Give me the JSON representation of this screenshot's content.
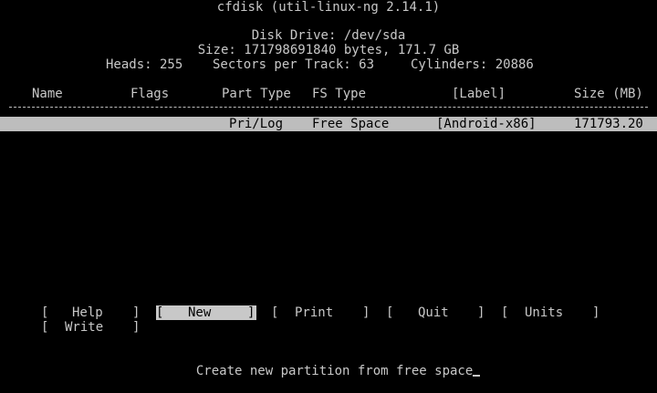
{
  "header": {
    "app_title": "cfdisk (util-linux-ng 2.14.1)",
    "disk_drive": "Disk Drive: /dev/sda",
    "size_line": "Size: 171798691840 bytes, 171.7 GB",
    "heads": "Heads: 255",
    "sectors": "Sectors per Track: 63",
    "cylinders": "Cylinders: 20886"
  },
  "table": {
    "columns": [
      "Name",
      "Flags",
      "Part Type",
      "FS Type",
      "[Label]",
      "Size (MB)"
    ],
    "rows": [
      {
        "name": "",
        "flags": "",
        "part_type": "Pri/Log",
        "fs_type": "Free Space",
        "label": "[Android-x86]",
        "size": "171793.20"
      }
    ]
  },
  "menu": {
    "open_bracket": "[",
    "close_bracket": "]",
    "items": [
      "Help",
      "New",
      "Print",
      "Quit",
      "Units",
      "Write"
    ],
    "selected": "New"
  },
  "status": {
    "message": "Create new partition from free space"
  }
}
